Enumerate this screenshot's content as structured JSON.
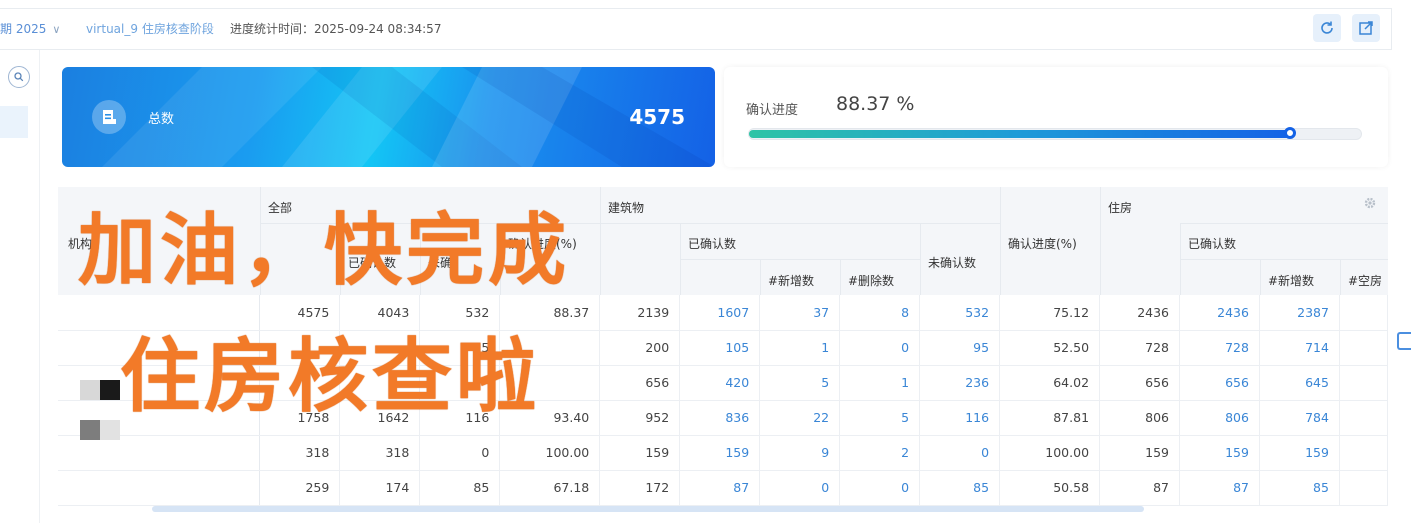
{
  "topbar": {
    "period": "期 2025",
    "stage": "virtual_9 住房核查阶段",
    "stat_time": "进度统计时间：2025-09-24 08:34:57"
  },
  "total_card": {
    "label": "总数",
    "value": "4575",
    "icon": "document-icon"
  },
  "progress_card": {
    "label": "确认进度",
    "value": "88.37 %",
    "fraction": 0.8837
  },
  "table": {
    "headers": {
      "org": "机构",
      "all": "全部",
      "all_confirmed": "已确认数",
      "all_unconfirmed": "未确",
      "all_progress": "确认进度(%)",
      "building": "建筑物",
      "b_confirmed": "已确认数",
      "b_new": "#新增数",
      "b_deleted": "#删除数",
      "b_unconfirmed": "未确认数",
      "b_progress": "确认进度(%)",
      "housing": "住房",
      "h_confirmed": "已确认数",
      "h_new": "#新增数",
      "h_vacant": "#空房"
    },
    "rows": [
      {
        "c": [
          "4575",
          "4043",
          "532",
          "88.37",
          "2139",
          "1607",
          "37",
          "8",
          "532",
          "75.12",
          "2436",
          "2436",
          "2387"
        ]
      },
      {
        "c": [
          "",
          "",
          "95",
          "",
          "200",
          "105",
          "1",
          "0",
          "95",
          "52.50",
          "728",
          "728",
          "714"
        ]
      },
      {
        "c": [
          "",
          "",
          "",
          "",
          "656",
          "420",
          "5",
          "1",
          "236",
          "64.02",
          "656",
          "656",
          "645"
        ]
      },
      {
        "c": [
          "1758",
          "1642",
          "116",
          "93.40",
          "952",
          "836",
          "22",
          "5",
          "116",
          "87.81",
          "806",
          "806",
          "784"
        ]
      },
      {
        "c": [
          "318",
          "318",
          "0",
          "100.00",
          "159",
          "159",
          "9",
          "2",
          "0",
          "100.00",
          "159",
          "159",
          "159"
        ]
      },
      {
        "c": [
          "259",
          "174",
          "85",
          "67.18",
          "172",
          "87",
          "0",
          "0",
          "85",
          "50.58",
          "87",
          "87",
          "85"
        ]
      }
    ]
  },
  "overlay": {
    "line1": "加油，快完成",
    "line2": "住房核查啦"
  },
  "colors": {
    "link": "#3a86d6",
    "caption": "#f27a28",
    "accent": "#1462e6"
  }
}
